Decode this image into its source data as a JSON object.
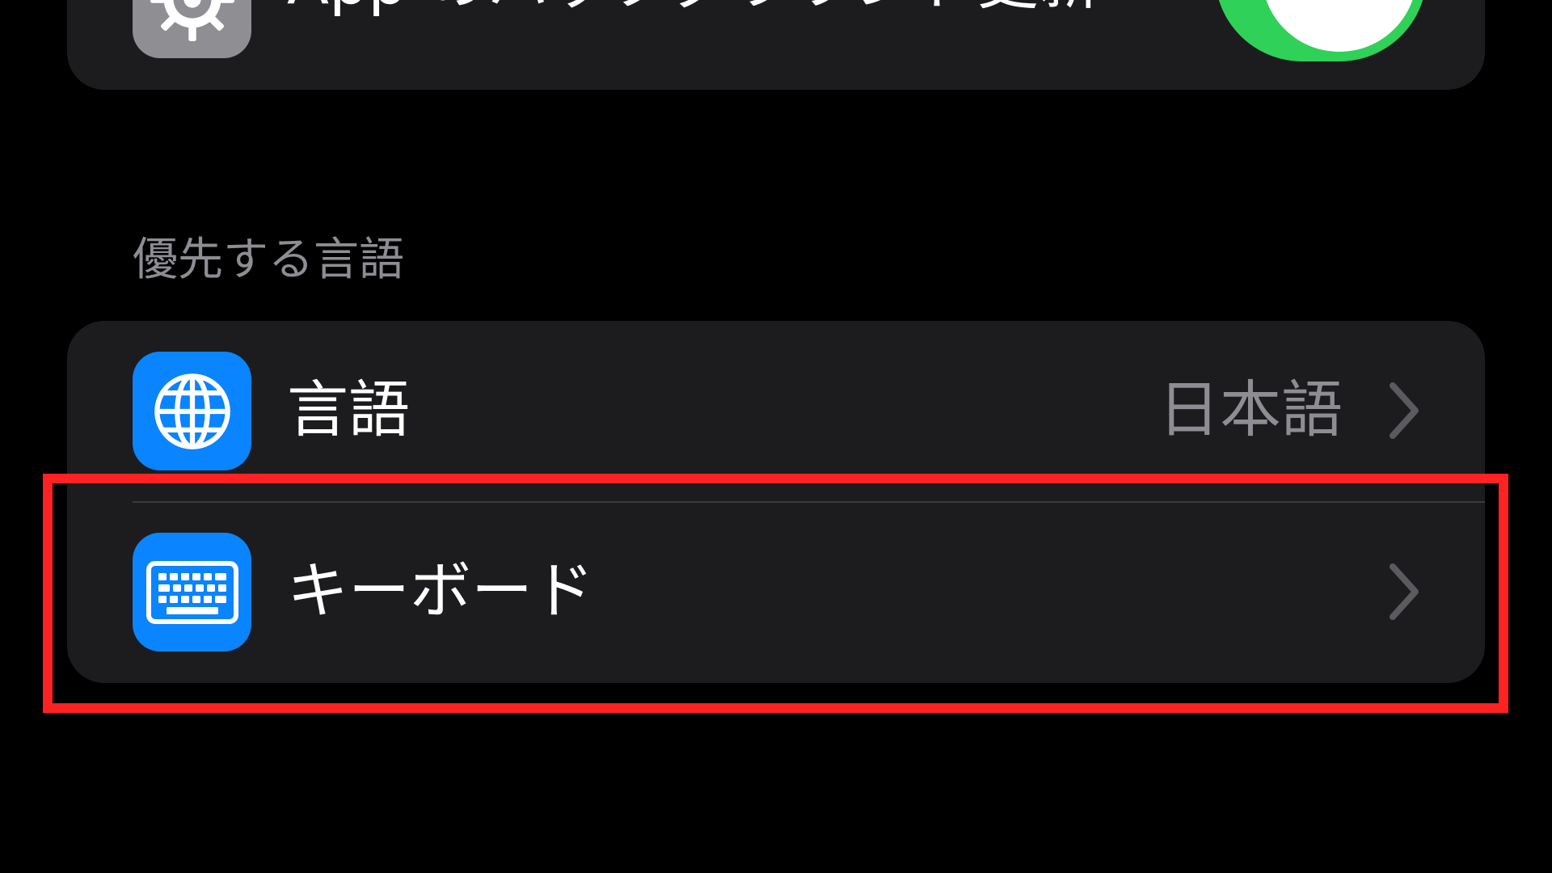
{
  "top_group": {
    "background_app_refresh": {
      "label": "App のバックグラウンド更新",
      "icon": "gear-icon",
      "toggle_on": true
    }
  },
  "language_section": {
    "header": "優先する言語",
    "items": [
      {
        "label": "言語",
        "value": "日本語",
        "icon": "globe-icon"
      },
      {
        "label": "キーボード",
        "value": "",
        "icon": "keyboard-icon"
      }
    ]
  },
  "colors": {
    "background": "#000000",
    "cell": "#1c1c1e",
    "toggle_on": "#30d158",
    "icon_blue": "#0a84ff",
    "icon_gray": "#8e8e93",
    "secondary_text": "#8d8d93",
    "highlight": "#ff2222"
  }
}
